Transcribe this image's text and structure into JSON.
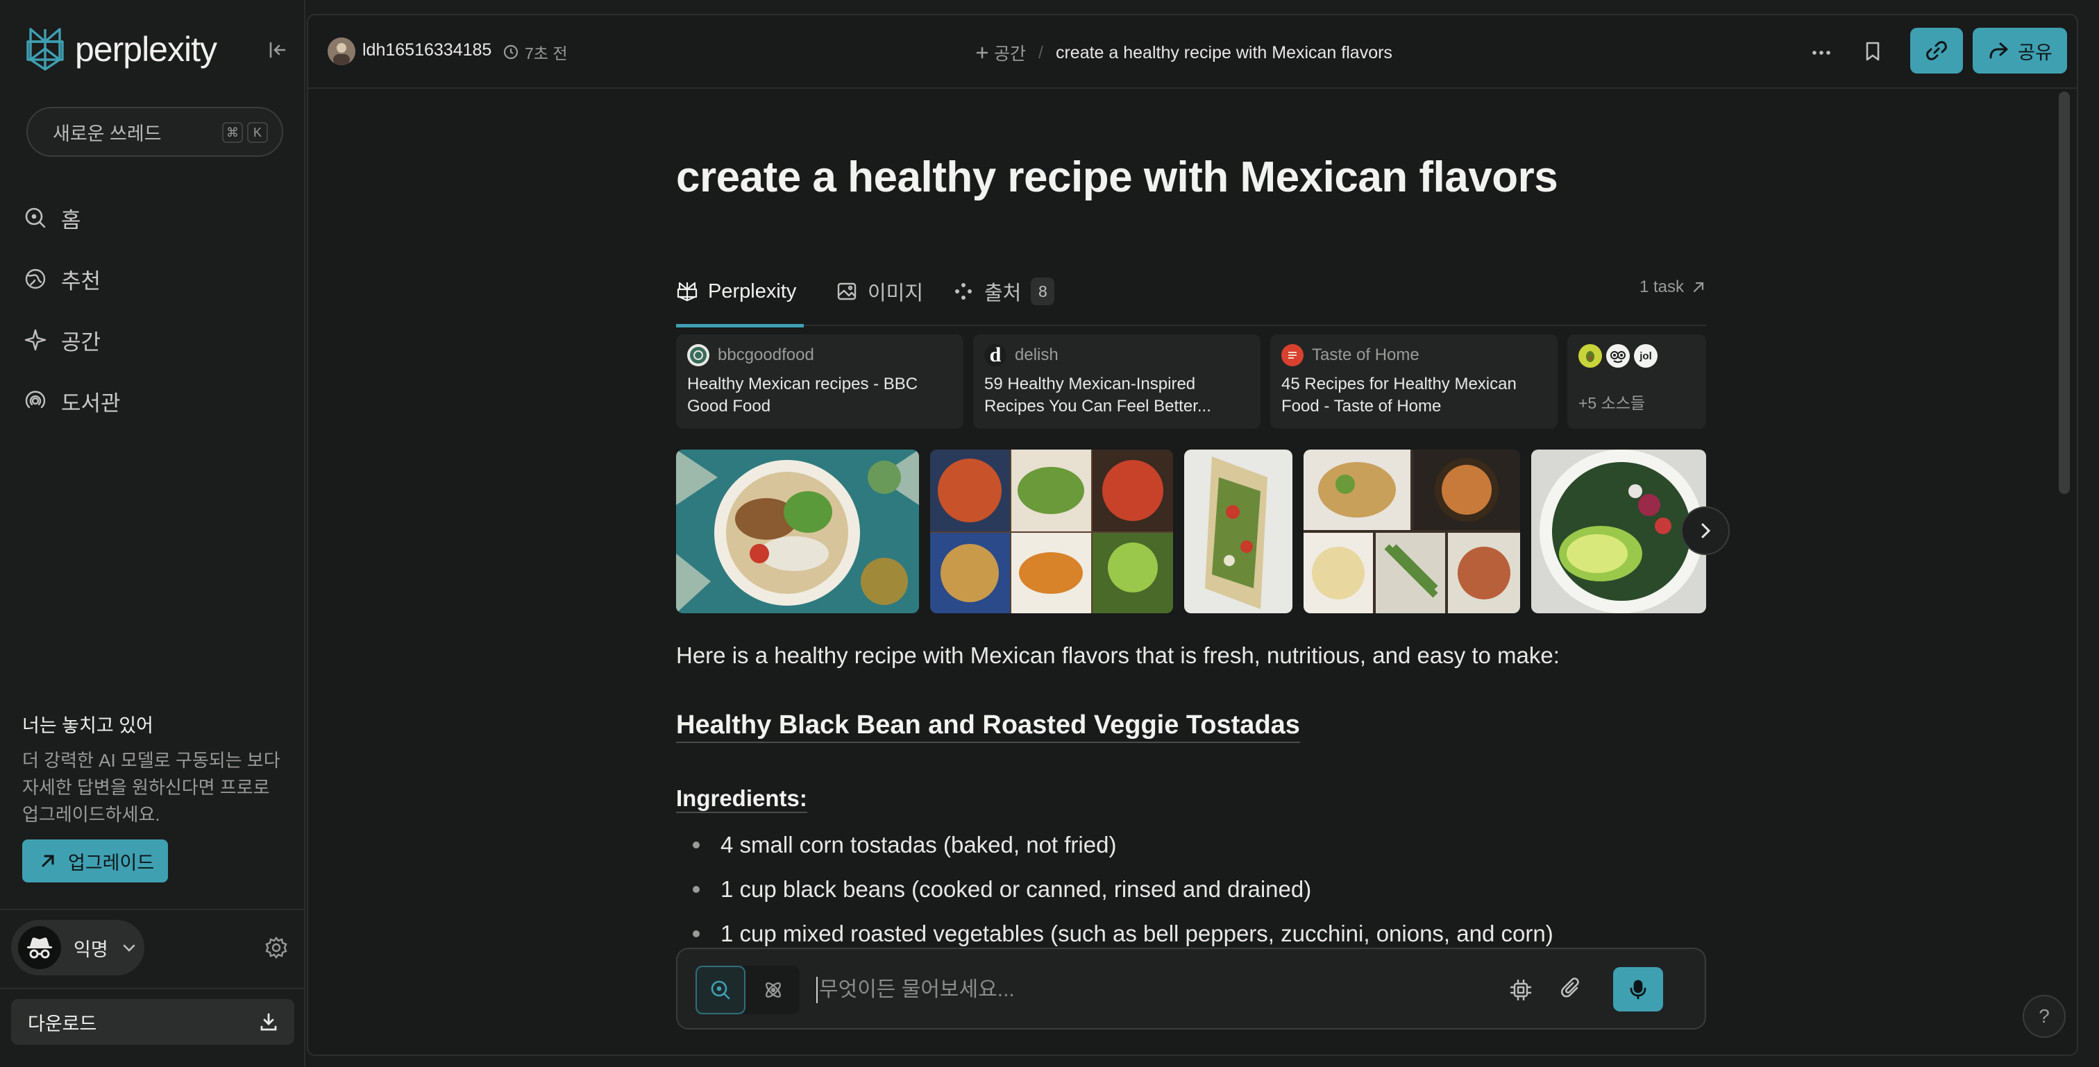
{
  "brand": {
    "name": "perplexity",
    "accent": "#3fa0b2"
  },
  "sidebar": {
    "new_thread_label": "새로운 쓰레드",
    "shortcut": [
      "⌘",
      "K"
    ],
    "nav": [
      {
        "label": "홈",
        "icon": "search-icon"
      },
      {
        "label": "추천",
        "icon": "globe-icon"
      },
      {
        "label": "공간",
        "icon": "sparkle-icon"
      },
      {
        "label": "도서관",
        "icon": "library-icon"
      }
    ],
    "promo": {
      "title": "너는 놓치고 있어",
      "text": "더 강력한 AI 모델로 구동되는 보다 자세한 답변을 원하신다면 프로로 업그레이드하세요.",
      "button": "업그레이드"
    },
    "user": {
      "name": "익명"
    },
    "download_label": "다운로드"
  },
  "topbar": {
    "username": "ldh16516334185",
    "time": "7초 전",
    "space_label": "공간",
    "separator": "/",
    "thread_title": "create a healthy recipe with Mexican flavors",
    "share_label": "공유"
  },
  "thread": {
    "title": "create a healthy recipe with Mexican flavors",
    "tabs": [
      {
        "label": "Perplexity",
        "icon": "perplexity-icon",
        "active": true
      },
      {
        "label": "이미지",
        "icon": "image-icon",
        "active": false
      },
      {
        "label": "출처",
        "icon": "sources-icon",
        "badge": "8",
        "active": false
      }
    ],
    "task_link": "1 task",
    "sources": [
      {
        "site": "bbcgoodfood",
        "title": "Healthy Mexican recipes - BBC Good Food",
        "fav": ""
      },
      {
        "site": "delish",
        "title": "59 Healthy Mexican-Inspired Recipes You Can Feel Better...",
        "fav": "d"
      },
      {
        "site": "Taste of Home",
        "title": "45 Recipes for Healthy Mexican Food - Taste of Home",
        "fav": ""
      }
    ],
    "more_sources_label": "+5 소스들",
    "more_favs": [
      "",
      "",
      "jol"
    ],
    "answer": {
      "intro": "Here is a healthy recipe with Mexican flavors that is fresh, nutritious, and easy to make:",
      "recipe_title": "Healthy Black Bean and Roasted Veggie Tostadas",
      "ingredients_title": "Ingredients:",
      "ingredients": [
        "4 small corn tostadas (baked, not fried)",
        "1 cup black beans (cooked or canned, rinsed and drained)",
        "1 cup mixed roasted vegetables (such as bell peppers, zucchini, onions, and corn)"
      ]
    }
  },
  "composer": {
    "placeholder": "무엇이든 물어보세요..."
  },
  "help_label": "?"
}
